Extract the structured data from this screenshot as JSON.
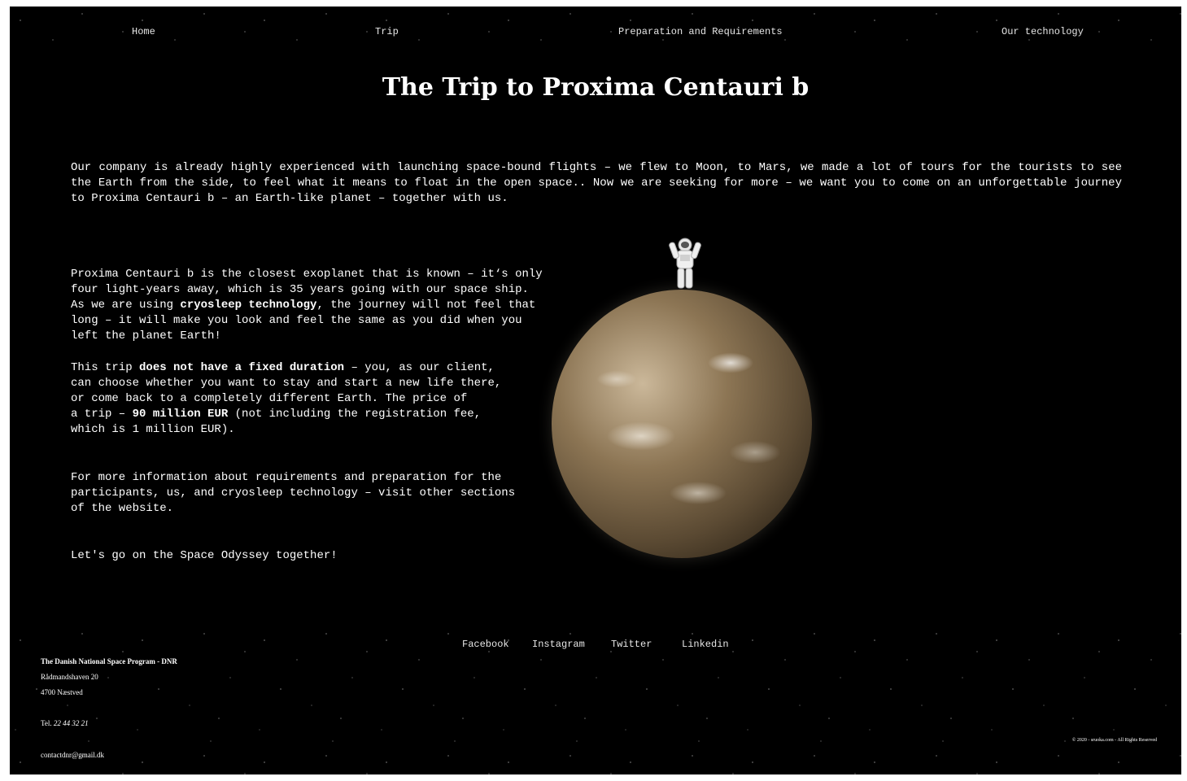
{
  "nav": {
    "items": [
      {
        "label": "Home"
      },
      {
        "label": "Trip"
      },
      {
        "label": "Preparation and Requirements"
      },
      {
        "label": "Our technology"
      }
    ]
  },
  "main": {
    "title": "The Trip to Proxima Centauri b",
    "intro": "Our company is already highly experienced with launching space-bound flights – we flew to Moon, to Mars, we made a lot of tours for the tourists to see the Earth from the side, to feel what it means to float in the open space.. Now we are seeking for more – we want you to come on an unforgettable journey to Proxima Centauri b – an Earth-like planet – together with us.",
    "para1": {
      "line1": "Proxima Centauri b is the closest exoplanet that is known – it‘s only",
      "line2": "four light-years away, which is 35 years going with our space ship.",
      "line3_a": "As we are using ",
      "line3_bold": "cryosleep technology",
      "line3_b": ", the journey will not feel that",
      "line4": "long – it will make you look and feel the same as you did when you",
      "line5": "left the planet Earth!"
    },
    "para2": {
      "line1_a": "This trip ",
      "line1_bold": "does not have a fixed duration",
      "line1_b": " – you, as our client,",
      "line2": "can choose whether you want to stay and start a new life there,",
      "line3": "or come back to a completely different Earth. The price of",
      "line4_a": "a trip – ",
      "line4_bold": "90 million EUR",
      "line4_b": " (not including the registration fee,",
      "line5": "which is 1 million EUR)."
    },
    "para3": {
      "line1": "For more information about requirements and preparation for the",
      "line2": "participants, us, and cryosleep technology – visit other sections",
      "line3": "of the website."
    },
    "para4": "Let's go on the Space Odyssey together!"
  },
  "footer": {
    "social": [
      {
        "label": "Facebook"
      },
      {
        "label": "Instagram"
      },
      {
        "label": "Twitter"
      },
      {
        "label": "Linkedin"
      }
    ],
    "org": "The Danish National Space Program - DNR",
    "street": "Rådmandshaven 20",
    "city": "4700 Næstved",
    "tel_label": "Tel. ",
    "tel_number": "22 44 32 21",
    "email": "contactdnr@gmail.dk",
    "copyright": "© 2020 - sruoka.com - All Rights Reserved"
  },
  "icons": {
    "astronaut": "astronaut-icon",
    "planet": "planet-image"
  }
}
